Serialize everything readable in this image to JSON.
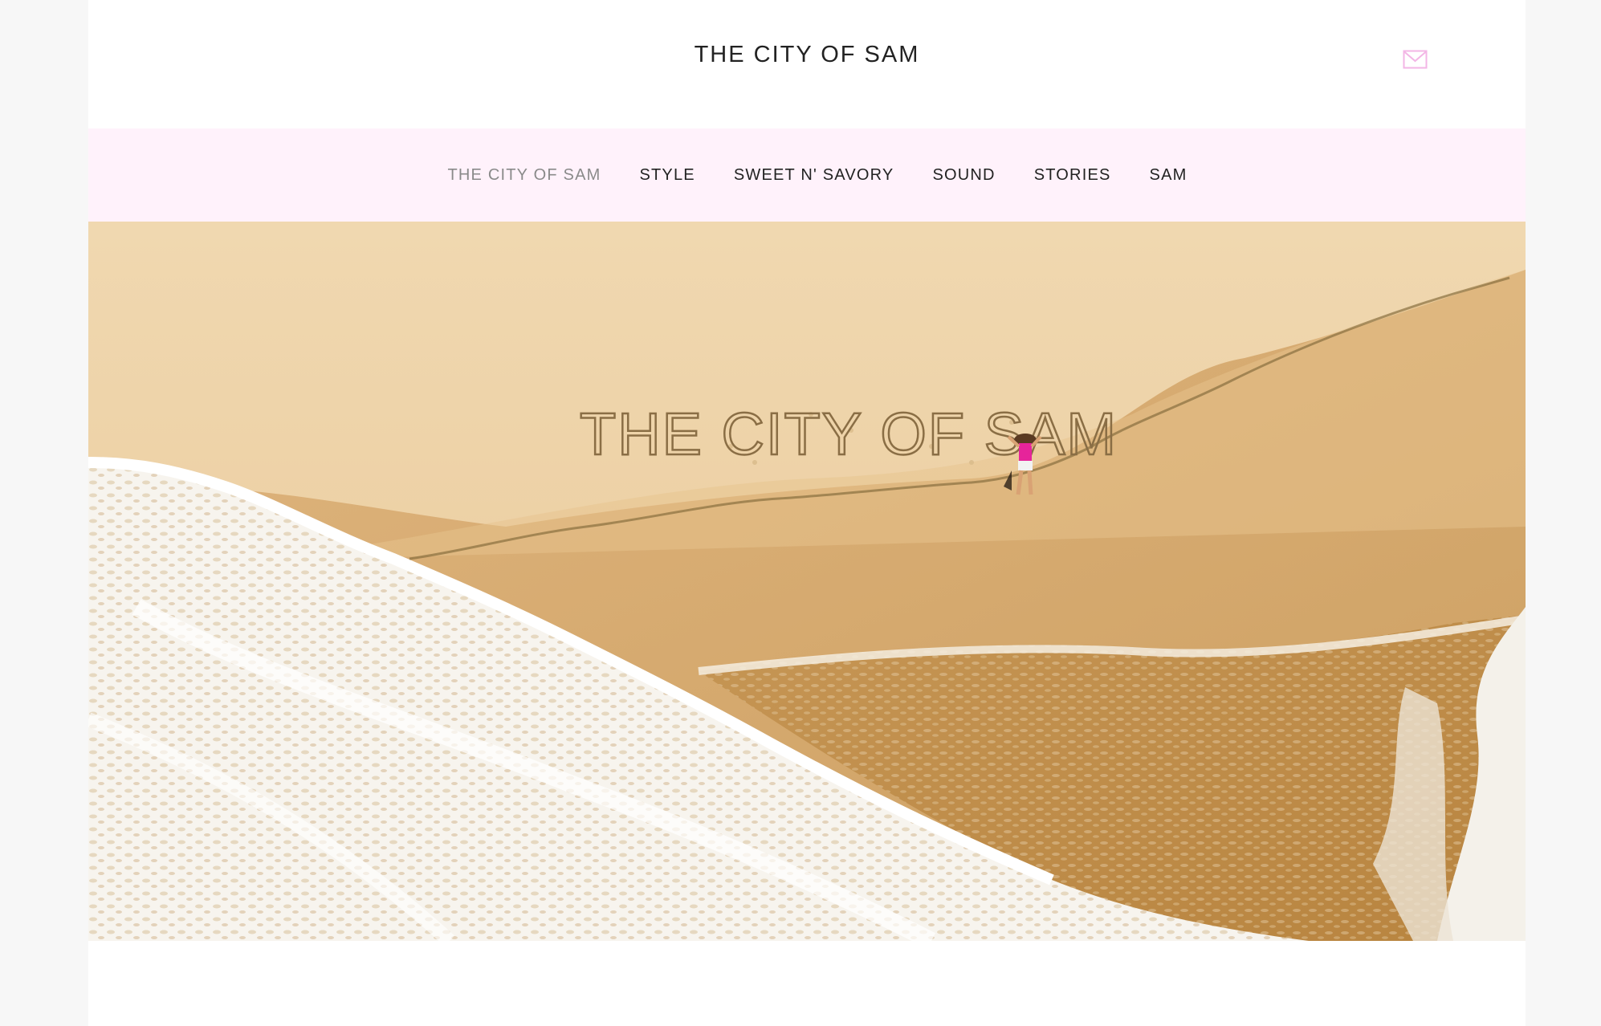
{
  "site": {
    "title": "THE CITY OF SAM"
  },
  "header": {
    "mail_icon": "envelope-icon",
    "accent_color": "#f3b6e6"
  },
  "nav": {
    "items": [
      {
        "label": "THE CITY OF SAM",
        "active": true
      },
      {
        "label": "STYLE",
        "active": false
      },
      {
        "label": "SWEET N' SAVORY",
        "active": false
      },
      {
        "label": "SOUND",
        "active": false
      },
      {
        "label": "STORIES",
        "active": false
      },
      {
        "label": "SAM",
        "active": false
      }
    ],
    "background": "#fff2fb"
  },
  "hero": {
    "sand_writing": "THE CITY OF SAM"
  }
}
